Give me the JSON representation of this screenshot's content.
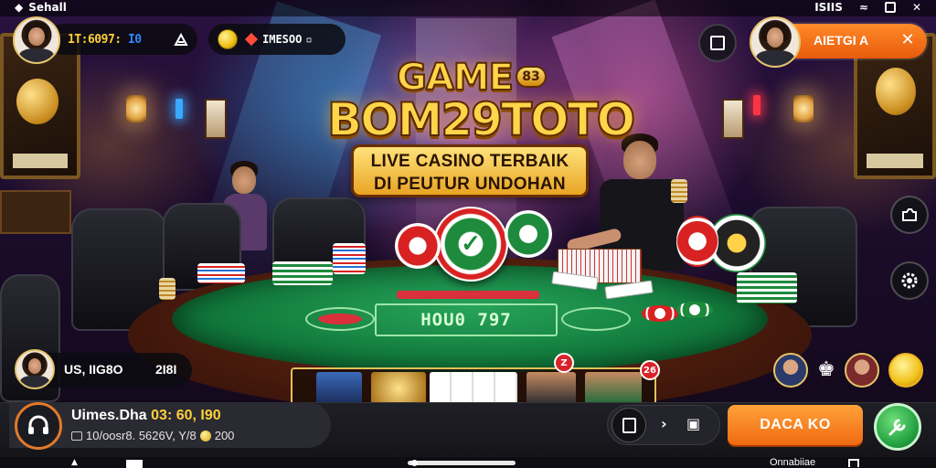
{
  "status_bar": {
    "left_text": "Sehall",
    "right_text": "ISIIS",
    "right_icon_names": [
      "wifi-icon",
      "battery-icon",
      "close-icon"
    ]
  },
  "top_hud": {
    "balance": {
      "main": "1T:6097:",
      "accent": "I0"
    },
    "coins": {
      "value": "IMESOO",
      "suffix": "▫"
    },
    "alert": {
      "label": "AIETGI A",
      "close": "✕"
    },
    "window_button_icon": "window-square-icon"
  },
  "logo": {
    "game": "GAME",
    "badge": "83",
    "brand": "BOM29TOTO",
    "line1": "LIVE CASINO TERBAIK",
    "line2": "DI PEUTUR UNDOHAN"
  },
  "table": {
    "panel_text": "HOU0 797",
    "player_left": {
      "label": "US, IIG8O",
      "value": "2I8I"
    },
    "tray_badges": [
      "Z",
      "26"
    ]
  },
  "account": {
    "name": "Uimes.Dha",
    "name_accent": "03: 60, I90",
    "sub_prefix": "10/oosr8. 5626V, Y/8",
    "sub_coins": "200"
  },
  "bottom_nav": {
    "cta_label": "DACA KO",
    "right_label": "Onnabiiae"
  },
  "colors": {
    "accent_orange": "#f06a12",
    "gold": "#ffd54a",
    "felt_green": "#117a3c",
    "cta_green": "#1c9a3c"
  }
}
